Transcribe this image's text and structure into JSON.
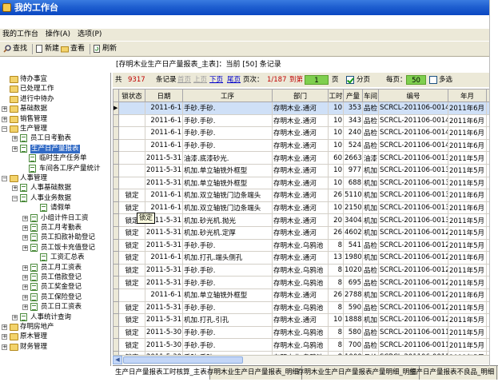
{
  "window": {
    "title": "我的工作台"
  },
  "menu": [
    "我的工作台",
    "操作(A)",
    "选项(P)"
  ],
  "toolbar": {
    "find": "查找",
    "new": "新建",
    "view": "查看",
    "refresh": "刷新"
  },
  "header": {
    "text": "[存明木业生产日产量报表_主表]：当前 [50] 条记录"
  },
  "navbar": {
    "total_prefix": "共",
    "total": "9317",
    "total_suffix": "条记录",
    "first": "首页",
    "prev": "上页",
    "next": "下页",
    "last": "尾页",
    "page_label": "页次：",
    "page": "1/187",
    "goto_label": "到第",
    "goto_value": "1",
    "goto_suffix": "页",
    "paging_label": "分页",
    "paging_checked": true,
    "per_page_label": "每页：",
    "per_page": "50",
    "multiselect_label": "多选",
    "multiselect_checked": false
  },
  "tree": [
    "待办事宜",
    "已处理工作",
    "进行中待办",
    "基础数据",
    "销售管理",
    "生产管理",
    "员工日考勤表",
    "生产日产量报表",
    "临时生产任务单",
    "车间各工序产量统计",
    "人事管理",
    "人事基础数据",
    "人事业务数据",
    "请假单",
    "小组计件日工资",
    "员工月考勤表",
    "员工扣款补助登记",
    "员工饭卡充值登记",
    "工资汇总表",
    "员工月工资表",
    "员工借款登记",
    "员工奖金登记",
    "员工保险登记",
    "员工日工资表",
    "人事统计查询",
    "存明房地产",
    "原木管理",
    "财务管理"
  ],
  "grid": {
    "columns": [
      "锁状态",
      "日期",
      "工序",
      "部门",
      "工时",
      "产量",
      "车间",
      "编号",
      "年月"
    ],
    "rows": [
      [
        "",
        "2011-6-1",
        "手砂.手砂.",
        "存明木业.通河",
        "10",
        "353",
        "品检",
        "SCRCL-201106-00143",
        "2011年6月"
      ],
      [
        "",
        "2011-6-1",
        "手砂.手砂.",
        "存明木业.通河",
        "10",
        "343",
        "品检",
        "SCRCL-201106-00142",
        "2011年6月"
      ],
      [
        "",
        "2011-6-1",
        "手砂.手砂.",
        "存明木业.通河",
        "10",
        "240",
        "品检",
        "SCRCL-201106-00141",
        "2011年6月"
      ],
      [
        "",
        "2011-6-1",
        "手砂.手砂.",
        "存明木业.通河",
        "10",
        "524",
        "品检",
        "SCRCL-201106-00140",
        "2011年6月"
      ],
      [
        "",
        "2011-5-31",
        "油漆.底漆砂光.",
        "存明木业.通河",
        "60",
        "2663",
        "油漆",
        "SCRCL-201106-00139",
        "2011年5月"
      ],
      [
        "",
        "2011-5-31",
        "机加.单立轴铣外框型",
        "存明木业.通河",
        "10",
        "977",
        "机加",
        "SCRCL-201106-00136",
        "2011年5月"
      ],
      [
        "",
        "2011-5-31",
        "机加.单立轴铣外框型",
        "存明木业.通河",
        "10",
        "688",
        "机加",
        "SCRCL-201106-00134",
        "2011年5月"
      ],
      [
        "锁定",
        "2011-6-1",
        "机加.双立轴铣门边条端头",
        "存明木业.通河",
        "26",
        "5110",
        "机加",
        "SCRCL-201106-00132",
        "2011年6月"
      ],
      [
        "锁定",
        "2011-6-1",
        "机加.双立轴铣门边条端头",
        "存明木业.通河",
        "10",
        "2150",
        "机加",
        "SCRCL-201106-00131",
        "2011年6月"
      ],
      [
        "锁定",
        "2011-5-31",
        "机加.砂光机.抛光",
        "存明木业.通河",
        "20",
        "3404",
        "机加",
        "SCRCL-201106-00130",
        "2011年5月"
      ],
      [
        "锁定",
        "2011-5-31",
        "机加.砂光机.定厚",
        "存明木业.通河",
        "26",
        "4602",
        "机加",
        "SCRCL-201106-00127",
        "2011年5月"
      ],
      [
        "锁定",
        "2011-5-31",
        "手砂.手砂.",
        "存明木业.乌鸦池",
        "8",
        "541",
        "品检",
        "SCRCL-201106-00126",
        "2011年5月"
      ],
      [
        "锁定",
        "2011-6-1",
        "机加.打孔.端头侧孔",
        "存明木业.通河",
        "13",
        "1980",
        "机加",
        "SCRCL-201106-00125",
        "2011年6月"
      ],
      [
        "锁定",
        "2011-5-31",
        "手砂.手砂.",
        "存明木业.乌鸦池",
        "8",
        "1020",
        "品检",
        "SCRCL-201106-00124",
        "2011年5月"
      ],
      [
        "锁定",
        "2011-5-31",
        "手砂.手砂.",
        "存明木业.乌鸦池",
        "8",
        "695",
        "品检",
        "SCRCL-201106-00123",
        "2011年5月"
      ],
      [
        "",
        "2011-6-1",
        "机加.单立轴铣外框型",
        "存明木业.通河",
        "26",
        "2788",
        "机加",
        "SCRCL-201106-00122",
        "2011年6月"
      ],
      [
        "锁定",
        "2011-5-31",
        "手砂.手砂.",
        "存明木业.乌鸦池",
        "8",
        "590",
        "品检",
        "SCRCL-201106-00121",
        "2011年5月"
      ],
      [
        "锁定",
        "2011-5-31",
        "机加.打孔.引孔",
        "存明木业.通河",
        "10",
        "1888",
        "机加",
        "SCRCL-201106-00120",
        "2011年5月"
      ],
      [
        "锁定",
        "2011-5-30",
        "手砂.手砂.",
        "存明木业.乌鸦池",
        "8",
        "580",
        "品检",
        "SCRCL-201106-00119",
        "2011年5月"
      ],
      [
        "锁定",
        "2011-5-30",
        "手砂.手砂.",
        "存明木业.乌鸦池",
        "8",
        "700",
        "品检",
        "SCRCL-201106-00118",
        "2011年5月"
      ],
      [
        "锁定",
        "2011-5-30",
        "手砂.手砂.",
        "存明木业.乌鸦池",
        "8",
        "1000",
        "品检",
        "SCRCL-201106-00117",
        "2011年5月"
      ]
    ]
  },
  "tooltip": "锁定",
  "tabs": [
    "生产日产量报表工时核算_主表",
    "存明木业生产日产量报表_明细",
    "存明木业生产日产量报表产量明细_明细",
    "生产日产量报表不良品_明细"
  ],
  "colors": {
    "title_bar": "#1f5fd0",
    "selection": "#316ac5",
    "accent_green": "#7fcf4f",
    "link": "#0000cc",
    "count_red": "#c00000"
  }
}
